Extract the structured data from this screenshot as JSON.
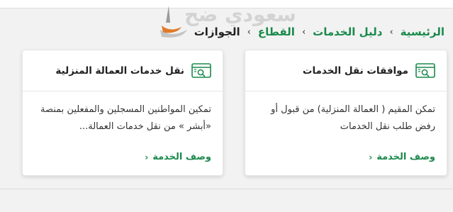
{
  "breadcrumb": {
    "items": [
      "الرئيسية",
      "دليل الخدمات",
      "القطاع",
      "الجوازات"
    ],
    "separator": "›"
  },
  "watermark": {
    "text": "سعودي ضح"
  },
  "cards": [
    {
      "title": "موافقات نقل الخدمات",
      "description": "تمكن المقيم ( العمالة المنزلية) من قبول أو رفض طلب نقل الخدمات",
      "link_label": "وصف الخدمة",
      "icon": "service-search-icon"
    },
    {
      "title": "نقل خدمات العمالة المنزلية",
      "description": "تمكين المواطنين المسجلين والمفعلين بمنصة «أبشر » من نقل خدمات العمالة...",
      "link_label": "وصف الخدمة",
      "icon": "service-search-icon"
    }
  ],
  "colors": {
    "accent": "#1a8a4b",
    "text": "#222222",
    "background": "#f2f2f2"
  }
}
